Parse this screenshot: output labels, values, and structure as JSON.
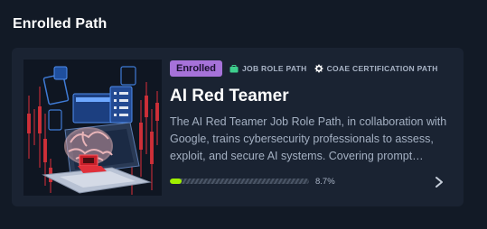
{
  "section": {
    "title": "Enrolled Path"
  },
  "card": {
    "badge": "Enrolled",
    "tags": [
      {
        "label": "JOB ROLE PATH",
        "icon": "briefcase-icon",
        "color": "#3ecf8e"
      },
      {
        "label": "COAE CERTIFICATION PATH",
        "icon": "gear-badge-icon",
        "color": "#ffffff"
      }
    ],
    "title": "AI Red Teamer",
    "description": "The AI Red Teamer Job Role Path, in collaboration with Google, trains cybersecurity professionals to assess, exploit, and secure AI systems. Covering prompt…",
    "progress": {
      "percent": 8.7,
      "label": "8.7%"
    }
  },
  "colors": {
    "background": "#121a26",
    "card": "#1a2332",
    "badge": "#a672d9",
    "progress_fill": "#9fef00",
    "accent_red": "#e0303a"
  }
}
